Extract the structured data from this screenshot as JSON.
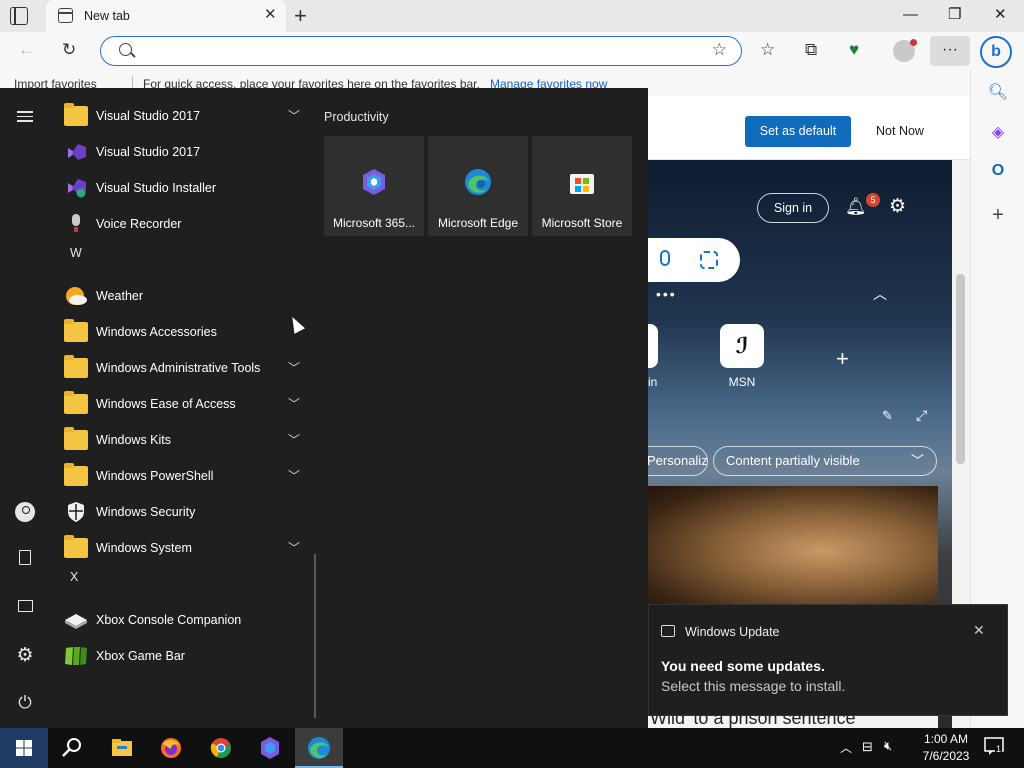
{
  "browser": {
    "tab_title": "New tab",
    "address_placeholder": "",
    "favorites_bar": {
      "import_label": "Import favorites",
      "hint": "For quick access, place your favorites here on the favorites bar.",
      "manage_link": "Manage favorites now"
    }
  },
  "banner": {
    "set_default_label": "Set as default",
    "not_now_label": "Not Now"
  },
  "ntp": {
    "sign_in_label": "Sign in",
    "notification_count": "5",
    "dots": "•••",
    "msn_tile_label": "MSN",
    "partial_tile_label": "in",
    "personalize_label": "Personalize",
    "content_visible_label": "Content partially visible",
    "news_headline_fragment": "Wild' to a prison sentence"
  },
  "start_menu": {
    "apps": [
      {
        "label": "Visual Studio 2017",
        "icon": "folder-icon",
        "expandable": true
      },
      {
        "label": "Visual Studio 2017",
        "icon": "visual-studio-icon",
        "expandable": false
      },
      {
        "label": "Visual Studio Installer",
        "icon": "visual-studio-installer-icon",
        "expandable": false
      },
      {
        "label": "Voice Recorder",
        "icon": "microphone-icon",
        "expandable": false
      },
      {
        "header": "W"
      },
      {
        "label": "Weather",
        "icon": "weather-icon",
        "expandable": false
      },
      {
        "label": "Windows Accessories",
        "icon": "folder-icon",
        "expandable": false
      },
      {
        "label": "Windows Administrative Tools",
        "icon": "folder-icon",
        "expandable": true
      },
      {
        "label": "Windows Ease of Access",
        "icon": "folder-icon",
        "expandable": true
      },
      {
        "label": "Windows Kits",
        "icon": "folder-icon",
        "expandable": true
      },
      {
        "label": "Windows PowerShell",
        "icon": "folder-icon",
        "expandable": true
      },
      {
        "label": "Windows Security",
        "icon": "shield-icon",
        "expandable": false
      },
      {
        "label": "Windows System",
        "icon": "folder-icon",
        "expandable": true
      },
      {
        "header": "X"
      },
      {
        "label": "Xbox Console Companion",
        "icon": "xbox-console-icon",
        "expandable": false
      },
      {
        "label": "Xbox Game Bar",
        "icon": "xbox-game-bar-icon",
        "expandable": false
      }
    ],
    "group_title": "Productivity",
    "pinned": [
      {
        "label": "Microsoft 365...",
        "icon": "microsoft-365-icon"
      },
      {
        "label": "Microsoft Edge",
        "icon": "edge-icon"
      },
      {
        "label": "Microsoft Store",
        "icon": "store-icon"
      }
    ]
  },
  "toast": {
    "app_name": "Windows Update",
    "title": "You need some updates.",
    "body": "Select this message to install."
  },
  "taskbar": {
    "apps": [
      "windows-start-icon",
      "search-icon",
      "file-explorer-icon",
      "firefox-icon",
      "chrome-icon",
      "microsoft-365-icon",
      "edge-icon"
    ],
    "time": "1:00 AM",
    "date": "7/6/2023",
    "notification_count": "1"
  },
  "colors": {
    "accent": "#0f6cbd",
    "start_menu_bg": "#1f1f1f",
    "folder": "#f4c542"
  }
}
